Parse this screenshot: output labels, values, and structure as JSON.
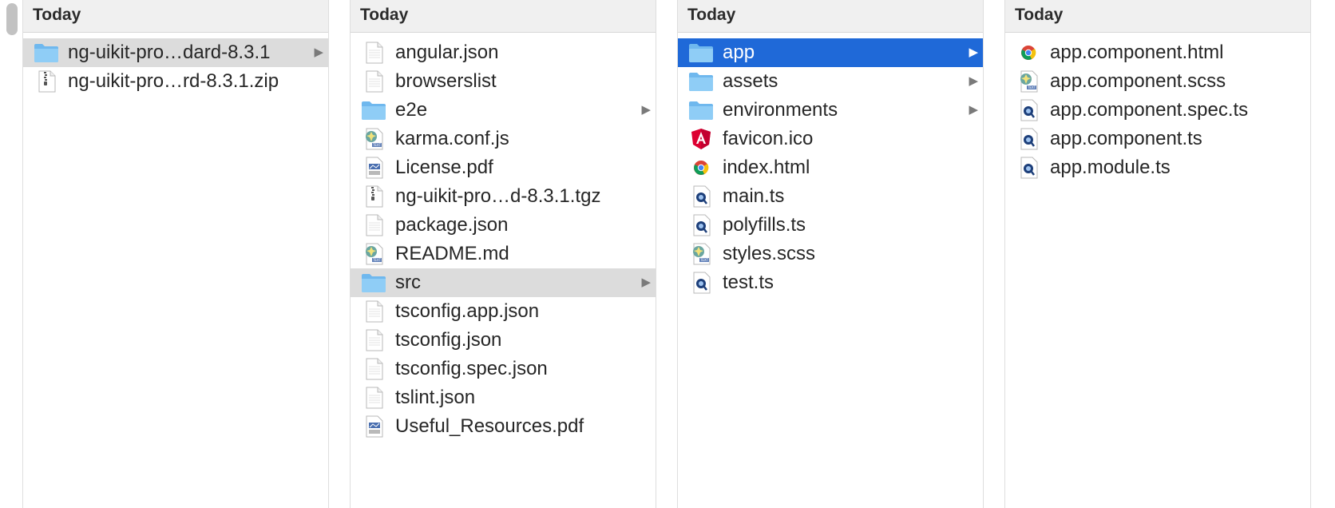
{
  "columns": [
    {
      "header": "Today",
      "items": [
        {
          "label": "ng-uikit-pro…dard-8.3.1",
          "icon": "folder-icon",
          "selected": "gray",
          "chevron": true
        },
        {
          "label": "ng-uikit-pro…rd-8.3.1.zip",
          "icon": "zip-file-icon",
          "selected": "",
          "chevron": false
        }
      ]
    },
    {
      "header": "Today",
      "items": [
        {
          "label": "angular.json",
          "icon": "document-icon",
          "selected": "",
          "chevron": false
        },
        {
          "label": "browserslist",
          "icon": "document-icon",
          "selected": "",
          "chevron": false
        },
        {
          "label": "e2e",
          "icon": "folder-icon",
          "selected": "",
          "chevron": true
        },
        {
          "label": "karma.conf.js",
          "icon": "script-file-icon",
          "selected": "",
          "chevron": false
        },
        {
          "label": "License.pdf",
          "icon": "pdf-file-icon",
          "selected": "",
          "chevron": false
        },
        {
          "label": "ng-uikit-pro…d-8.3.1.tgz",
          "icon": "zip-file-icon",
          "selected": "",
          "chevron": false
        },
        {
          "label": "package.json",
          "icon": "document-icon",
          "selected": "",
          "chevron": false
        },
        {
          "label": "README.md",
          "icon": "script-file-icon",
          "selected": "",
          "chevron": false
        },
        {
          "label": "src",
          "icon": "folder-icon",
          "selected": "gray",
          "chevron": true
        },
        {
          "label": "tsconfig.app.json",
          "icon": "document-icon",
          "selected": "",
          "chevron": false
        },
        {
          "label": "tsconfig.json",
          "icon": "document-icon",
          "selected": "",
          "chevron": false
        },
        {
          "label": "tsconfig.spec.json",
          "icon": "document-icon",
          "selected": "",
          "chevron": false
        },
        {
          "label": "tslint.json",
          "icon": "document-icon",
          "selected": "",
          "chevron": false
        },
        {
          "label": "Useful_Resources.pdf",
          "icon": "pdf-file-icon",
          "selected": "",
          "chevron": false
        }
      ]
    },
    {
      "header": "Today",
      "items": [
        {
          "label": "app",
          "icon": "folder-icon",
          "selected": "blue",
          "chevron": true
        },
        {
          "label": "assets",
          "icon": "folder-icon",
          "selected": "",
          "chevron": true
        },
        {
          "label": "environments",
          "icon": "folder-icon",
          "selected": "",
          "chevron": true
        },
        {
          "label": "favicon.ico",
          "icon": "angular-icon",
          "selected": "",
          "chevron": false
        },
        {
          "label": "index.html",
          "icon": "chrome-file-icon",
          "selected": "",
          "chevron": false
        },
        {
          "label": "main.ts",
          "icon": "quicklook-file-icon",
          "selected": "",
          "chevron": false
        },
        {
          "label": "polyfills.ts",
          "icon": "quicklook-file-icon",
          "selected": "",
          "chevron": false
        },
        {
          "label": "styles.scss",
          "icon": "script-file-icon",
          "selected": "",
          "chevron": false
        },
        {
          "label": "test.ts",
          "icon": "quicklook-file-icon",
          "selected": "",
          "chevron": false
        }
      ]
    },
    {
      "header": "Today",
      "items": [
        {
          "label": "app.component.html",
          "icon": "chrome-file-icon",
          "selected": "",
          "chevron": false
        },
        {
          "label": "app.component.scss",
          "icon": "script-file-icon",
          "selected": "",
          "chevron": false
        },
        {
          "label": "app.component.spec.ts",
          "icon": "quicklook-file-icon",
          "selected": "",
          "chevron": false
        },
        {
          "label": "app.component.ts",
          "icon": "quicklook-file-icon",
          "selected": "",
          "chevron": false
        },
        {
          "label": "app.module.ts",
          "icon": "quicklook-file-icon",
          "selected": "",
          "chevron": false
        }
      ]
    }
  ],
  "colors": {
    "selection_blue": "#1f69d8",
    "selection_gray": "#dcdcdc",
    "folder_blue": "#7cc1f2",
    "header_bg": "#f0f0f0"
  }
}
